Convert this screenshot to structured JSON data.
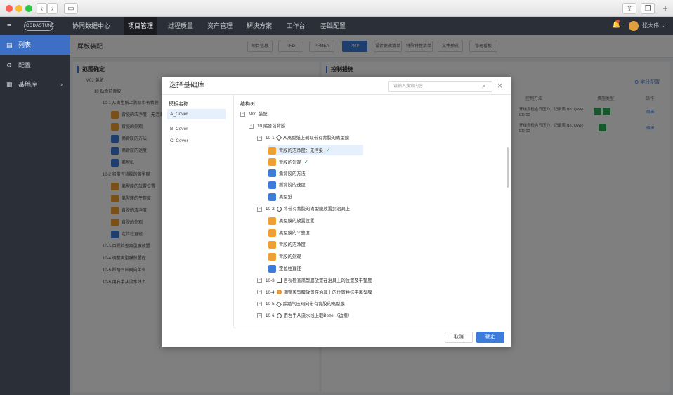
{
  "nav": {
    "logo": "ICODASTUNE",
    "items": [
      "协同数据中心",
      "项目管理",
      "过程质量",
      "资产管理",
      "解决方案",
      "工作台",
      "基础配置"
    ],
    "user": "张大伟"
  },
  "sidebar": {
    "items": [
      "列表",
      "配置",
      "基础库"
    ]
  },
  "subbar": {
    "title": "屏板装配",
    "tabs": [
      "项目信息",
      "PFD",
      "PFMEA",
      "PMP",
      "设计更改清单",
      "特殊特性清单",
      "文件预览",
      "管理看板"
    ]
  },
  "left_panel": {
    "title": "范围确定",
    "rows": [
      "M01 装配",
      "10 贴合前背胶",
      "10-1 从离型纸上剥取带有背胶",
      "背胶的洁净度：无污染",
      "背胶的外观",
      "撕背胶的方法",
      "撕背胶的速度",
      "离型纸",
      "10-2 将带有背胶的离型膜",
      "离型膜的放置位置",
      "离型膜的平整度",
      "背胶的洁净度",
      "背胶的外观",
      "定位柱直径",
      "10-3 目视检查离型膜放置",
      "10-4 调整离型膜放置在",
      "10-5 踩踏气压阀向带有",
      "10-6 用右手从流水线上"
    ]
  },
  "right_panel": {
    "title": "控制措施",
    "add_button": "字段配置",
    "headers": [
      "控制方法",
      "措施类型",
      "操作"
    ],
    "rows": [
      {
        "method": "开线点检含气压力，记录表 No. QWR-ED-02",
        "action": "编辑"
      },
      {
        "method": "开线点检含气压力，记录表 No. QWR-ED-02",
        "action": "编辑"
      }
    ]
  },
  "modal": {
    "title": "选择基础库",
    "search_placeholder": "请输入搜索内容",
    "left_header": "模板名称",
    "templates": [
      "A_Cover",
      "B_Cover",
      "C_Cover"
    ],
    "tree_header": "结构树",
    "tree": [
      {
        "label": "M01 装配",
        "level": 0,
        "kind": "toggle"
      },
      {
        "label": "10 贴合前背胶",
        "level": 1,
        "kind": "toggle"
      },
      {
        "label": "10-1",
        "text": "从离型纸上剥取带有背胶的离型膜",
        "level": 2,
        "kind": "toggle",
        "shape": "diamond"
      },
      {
        "label": "背胶的洁净度：无污染",
        "level": 3,
        "kind": "item",
        "icon": "orange",
        "check": true,
        "highlight": true
      },
      {
        "label": "背胶的外观",
        "level": 3,
        "kind": "item",
        "icon": "orange",
        "check": true
      },
      {
        "label": "撕背胶的方法",
        "level": 3,
        "kind": "item",
        "icon": "blue"
      },
      {
        "label": "撕背胶的速度",
        "level": 3,
        "kind": "item",
        "icon": "blue"
      },
      {
        "label": "离型纸",
        "level": 3,
        "kind": "item",
        "icon": "blue"
      },
      {
        "label": "10-2",
        "text": "将带有背胶的离型膜放置到治具上",
        "level": 2,
        "kind": "toggle",
        "shape": "circle"
      },
      {
        "label": "离型膜的放置位置",
        "level": 3,
        "kind": "item",
        "icon": "orange"
      },
      {
        "label": "离型膜的平整度",
        "level": 3,
        "kind": "item",
        "icon": "orange"
      },
      {
        "label": "背胶的洁净度",
        "level": 3,
        "kind": "item",
        "icon": "orange"
      },
      {
        "label": "背胶的外观",
        "level": 3,
        "kind": "item",
        "icon": "orange"
      },
      {
        "label": "定位柱直径",
        "level": 3,
        "kind": "item",
        "icon": "blue"
      },
      {
        "label": "10-3",
        "text": "目视检查离型膜放置在治具上的位置及平整度",
        "level": 2,
        "kind": "toggle",
        "shape": "square"
      },
      {
        "label": "10-4",
        "text": "调整离型膜放置在治具上的位置并抹平离型膜",
        "level": 2,
        "kind": "toggle",
        "shape": "circle-filled"
      },
      {
        "label": "10-5",
        "text": "踩踏气压阀向带有背胶的离型膜",
        "level": 2,
        "kind": "toggle",
        "shape": "diamond"
      },
      {
        "label": "10-6",
        "text": "用右手从流水线上取Bezel（边框）",
        "level": 2,
        "kind": "toggle",
        "shape": "circle"
      }
    ],
    "cancel": "取消",
    "ok": "确定"
  }
}
